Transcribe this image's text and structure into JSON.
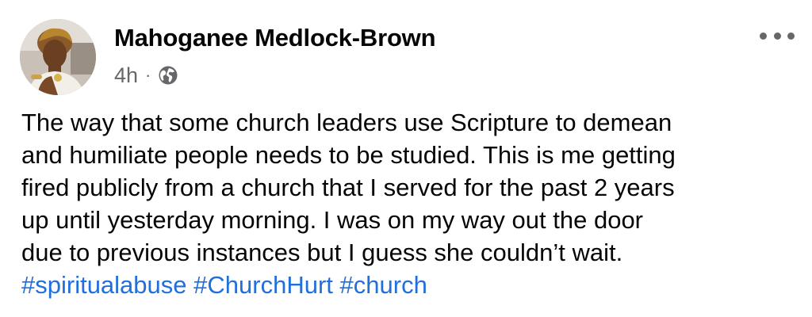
{
  "post": {
    "author": "Mahoganee Medlock-Brown",
    "timestamp": "4h",
    "separator": "·",
    "privacy_icon": "globe-icon",
    "more_icon": "more-options-icon",
    "body_lines": [
      "The way that some church leaders use Scripture to demean",
      "and humiliate people needs to be studied. This is me getting",
      "fired publicly from a church that I served for the past 2 years",
      "up until yesterday morning. I was on my way out the door",
      "due to previous instances but I guess she couldn’t wait."
    ],
    "hashtags": [
      "#spiritualabuse",
      "#ChurchHurt",
      "#church"
    ]
  },
  "colors": {
    "text": "#050505",
    "secondary_text": "#65676b",
    "hashtag": "#216fdb",
    "background": "#ffffff"
  }
}
